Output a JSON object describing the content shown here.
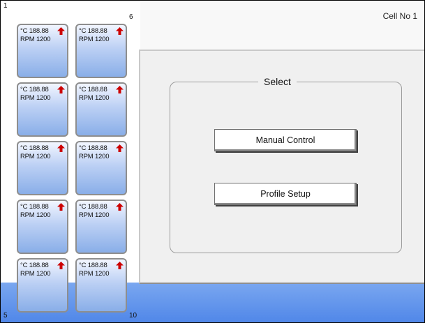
{
  "header": {
    "cell_label": "Cell No 1"
  },
  "corners": {
    "top_left": "1",
    "top_right": "6",
    "bottom_left": "5",
    "bottom_right": "10"
  },
  "tiles": [
    {
      "temp": "°C 188.88",
      "rpm": "RPM 1200",
      "trend_icon": "up-arrow-icon",
      "trend_color": "#cc0000"
    },
    {
      "temp": "°C 188.88",
      "rpm": "RPM 1200",
      "trend_icon": "up-arrow-icon",
      "trend_color": "#cc0000"
    },
    {
      "temp": "°C 188.88",
      "rpm": "RPM 1200",
      "trend_icon": "up-arrow-icon",
      "trend_color": "#cc0000"
    },
    {
      "temp": "°C 188.88",
      "rpm": "RPM 1200",
      "trend_icon": "up-arrow-icon",
      "trend_color": "#cc0000"
    },
    {
      "temp": "°C 188.88",
      "rpm": "RPM 1200",
      "trend_icon": "up-arrow-icon",
      "trend_color": "#cc0000"
    },
    {
      "temp": "°C 188.88",
      "rpm": "RPM 1200",
      "trend_icon": "up-arrow-icon",
      "trend_color": "#cc0000"
    },
    {
      "temp": "°C 188.88",
      "rpm": "RPM 1200",
      "trend_icon": "up-arrow-icon",
      "trend_color": "#cc0000"
    },
    {
      "temp": "°C 188.88",
      "rpm": "RPM 1200",
      "trend_icon": "up-arrow-icon",
      "trend_color": "#cc0000"
    },
    {
      "temp": "°C 188.88",
      "rpm": "RPM 1200",
      "trend_icon": "up-arrow-icon",
      "trend_color": "#cc0000"
    },
    {
      "temp": "°C 188.88",
      "rpm": "RPM 1200",
      "trend_icon": "up-arrow-icon",
      "trend_color": "#cc0000"
    }
  ],
  "select_panel": {
    "title": "Select",
    "buttons": [
      {
        "label": "Manual Control"
      },
      {
        "label": "Profile Setup"
      }
    ]
  },
  "colors": {
    "accent_blue": "#5b8fe8",
    "tile_gradient_top": "#f2f6ff",
    "tile_gradient_bottom": "#89aee8"
  }
}
